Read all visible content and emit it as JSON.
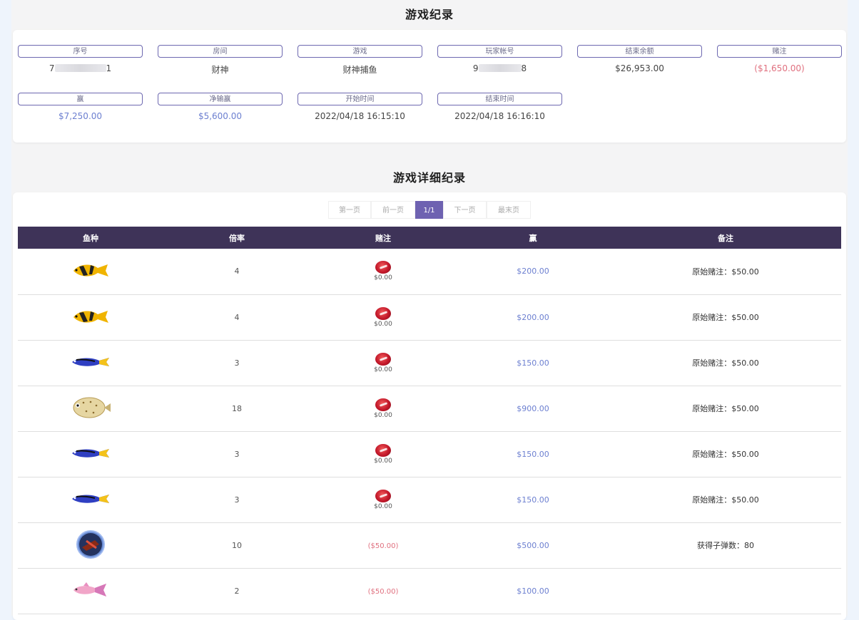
{
  "summary": {
    "title": "游戏纪录",
    "fields": [
      {
        "label": "序号",
        "value": "7",
        "value_suffix": "1",
        "masked": true,
        "tone": "normal"
      },
      {
        "label": "房间",
        "value": "财神",
        "tone": "normal"
      },
      {
        "label": "游戏",
        "value": "财神捕鱼",
        "tone": "normal"
      },
      {
        "label": "玩家帐号",
        "value": "9",
        "value_suffix": "8",
        "masked": true,
        "tone": "normal"
      },
      {
        "label": "结束余额",
        "value": "$26,953.00",
        "tone": "normal"
      },
      {
        "label": "赌注",
        "value": "($1,650.00)",
        "tone": "red"
      },
      {
        "label": "赢",
        "value": "$7,250.00",
        "tone": "blue"
      },
      {
        "label": "净输赢",
        "value": "$5,600.00",
        "tone": "blue"
      },
      {
        "label": "开始时间",
        "value": "2022/04/18 16:15:10",
        "tone": "normal"
      },
      {
        "label": "结束时间",
        "value": "2022/04/18 16:16:10",
        "tone": "normal"
      }
    ]
  },
  "detail": {
    "title": "游戏详细纪录",
    "pager": {
      "first": "第一页",
      "prev": "前一页",
      "current": "1/1",
      "next": "下一页",
      "last": "最末页"
    },
    "columns": [
      "鱼种",
      "倍率",
      "赌注",
      "赢",
      "备注"
    ],
    "rows": [
      {
        "fish": "yellow-butterflyfish",
        "rate": "4",
        "bet": "$0.00",
        "bet_coin": true,
        "win": "$200.00",
        "note": "原始赌注：$50.00"
      },
      {
        "fish": "yellow-butterflyfish",
        "rate": "4",
        "bet": "$0.00",
        "bet_coin": true,
        "win": "$200.00",
        "note": "原始赌注：$50.00"
      },
      {
        "fish": "blue-tang",
        "rate": "3",
        "bet": "$0.00",
        "bet_coin": true,
        "win": "$150.00",
        "note": "原始赌注：$50.00"
      },
      {
        "fish": "pufferfish",
        "rate": "18",
        "bet": "$0.00",
        "bet_coin": true,
        "win": "$900.00",
        "note": "原始赌注：$50.00"
      },
      {
        "fish": "blue-tang",
        "rate": "3",
        "bet": "$0.00",
        "bet_coin": true,
        "win": "$150.00",
        "note": "原始赌注：$50.00"
      },
      {
        "fish": "blue-tang",
        "rate": "3",
        "bet": "$0.00",
        "bet_coin": true,
        "win": "$150.00",
        "note": "原始赌注：$50.00"
      },
      {
        "fish": "cannon-medal",
        "rate": "10",
        "bet": "($50.00)",
        "bet_coin": false,
        "win": "$500.00",
        "note": "获得子弹数：80"
      },
      {
        "fish": "pink-fish",
        "rate": "2",
        "bet": "($50.00)",
        "bet_coin": false,
        "win": "$100.00",
        "note": ""
      }
    ]
  },
  "colors": {
    "header_bg": "#3e3358",
    "accent": "#6e62b1",
    "positive": "#6c7fd0",
    "negative": "#e0707f"
  }
}
